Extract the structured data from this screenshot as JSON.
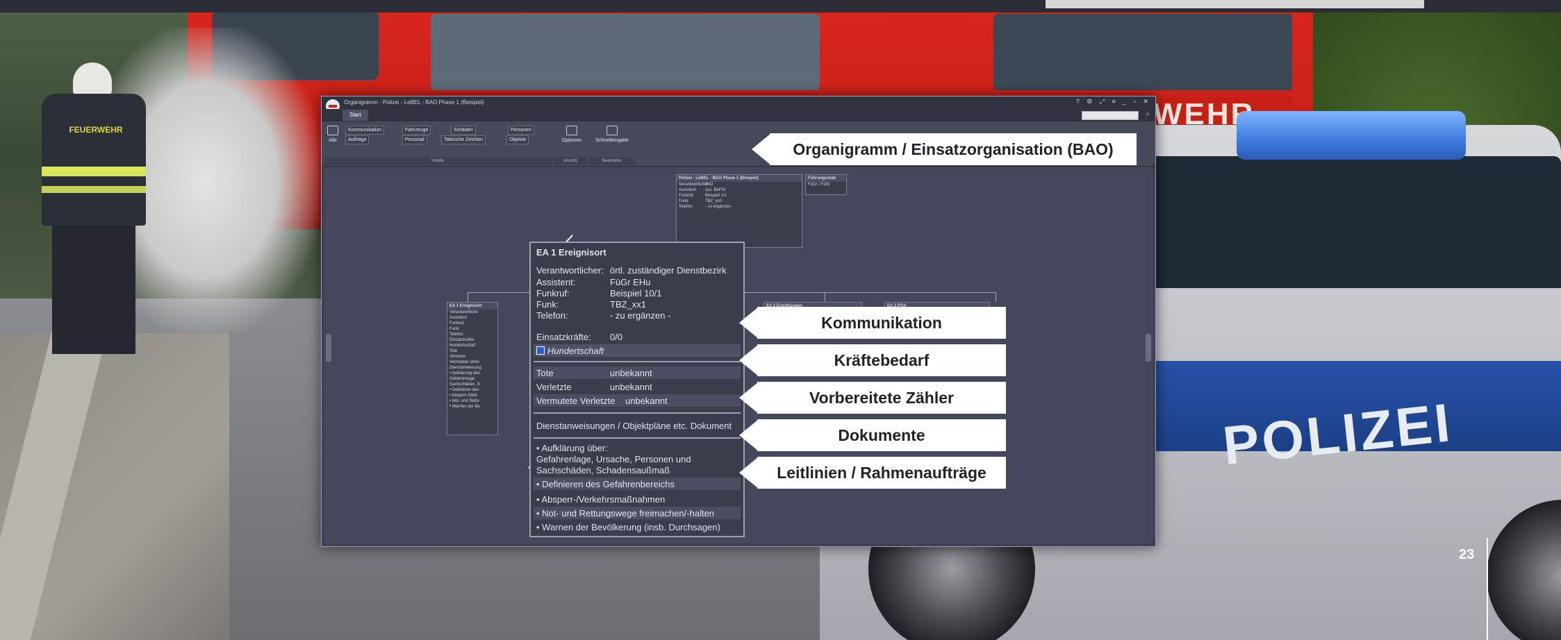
{
  "app": {
    "window_title": "Organigramm - Polizei - LeBEL - BAO Phase 1 (Beispiel)",
    "window_controls": "? ⚙ ⤢ ≡ _ ▫ ✕",
    "tab": "Start",
    "search_placeholder": ""
  },
  "ribbon": {
    "alle": "Alle",
    "buttons": {
      "kommunikation": "Kommunikation",
      "fahrzeuge": "Fahrzeuge",
      "schaeden": "Schäden",
      "personen": "Personen",
      "auftraege": "Aufträge",
      "personal": "Personal",
      "taktische_zeichen": "Taktische Zeichen",
      "objekte": "Objekte"
    },
    "optionen": "Optionen",
    "schnelleingabe": "Schnelleingabe",
    "groups": [
      "Inhalte",
      "Ansicht",
      "Bearbeiten"
    ]
  },
  "org_nodes": {
    "root": {
      "title": "Polizei - LeBEL - BAO Phase 1 (Beispiel)",
      "rows": [
        {
          "k": "Verantwortlicher:",
          "v": "PvD"
        },
        {
          "k": "Assistent:",
          "v": "zus. BeFSt"
        },
        {
          "k": "Funkruf:",
          "v": "Beispiel 1/1"
        },
        {
          "k": "Funk:",
          "v": "TBZ_xx0"
        },
        {
          "k": "Telefon:",
          "v": "- zu ergänzen -"
        }
      ]
    },
    "fuehrungsstab": {
      "title": "Führungsstab",
      "sub": "FüGr / FüSt"
    },
    "ea1_small": {
      "title": "EA 1 Ereignisort",
      "rows": [
        "Verantwortliche",
        "Assistent:",
        "Funkruf:",
        "Funk:",
        "Telefon:",
        "Einsatzkräfte:",
        "Hundertschaft",
        "Tote",
        "Verletzte",
        "Vermutete Verle",
        "Dienstanweisung",
        "• Aufklärung übe",
        "Gefahrenlage,",
        "Sachschäden, S",
        "• Definieren des",
        "• Absperr-/Verk",
        "• Not- und Rettu",
        "• Warnen der Be"
      ]
    },
    "ea2": {
      "title": "EA 2 Ermittlungen"
    },
    "ea3": {
      "title": "EA 3 PÖA"
    }
  },
  "zoom": {
    "title": "EA 1 Ereignisort",
    "rows": [
      {
        "k": "Verantwortlicher:",
        "v": "örtl. zuständiger Dienstbezirk"
      },
      {
        "k": "Assistent:",
        "v": "FüGr EHu"
      },
      {
        "k": "Funkruf:",
        "v": "Beispiel 10/1"
      },
      {
        "k": "Funk:",
        "v": "TBZ_xx1"
      },
      {
        "k": "Telefon:",
        "v": "- zu ergänzen -"
      }
    ],
    "einsatzkraefte_label": "Einsatzkräfte:",
    "einsatzkraefte_value": "0/0",
    "hundertschaft": "Hundertschaft",
    "counters": [
      {
        "k": "Tote",
        "v": "unbekannt"
      },
      {
        "k": "Verletzte",
        "v": "unbekannt"
      },
      {
        "k": "Vermutete Verletzte",
        "v": "unbekannt"
      }
    ],
    "documents": "Dienstanweisungen / Objektpläne etc.  Dokument",
    "guidelines": [
      "• Aufklärung über:",
      "  Gefahrenlage, Ursache, Personen und",
      "  Sachschäden, Schadensaußmaß",
      "• Definieren des Gefahrenbereichs",
      "• Absperr-/Verkehrsmaßnahmen",
      "• Not- und Rettungswege freimachen/-halten",
      "• Warnen der Bevölkerung (insb. Durchsagen)"
    ]
  },
  "callouts": {
    "organigramm": "Organigramm / Einsatzorganisation (BAO)",
    "kommunikation": "Kommunikation",
    "kraeftebedarf": "Kräftebedarf",
    "zaehler": "Vorbereitete Zähler",
    "dokumente": "Dokumente",
    "leitlinien": "Leitlinien / Rahmenaufträge"
  },
  "background": {
    "feuerwehr_label": "FEUERWEHR",
    "wehr_label": "WEHR",
    "polizei_label": "POLIZEI"
  },
  "page_number": "23"
}
